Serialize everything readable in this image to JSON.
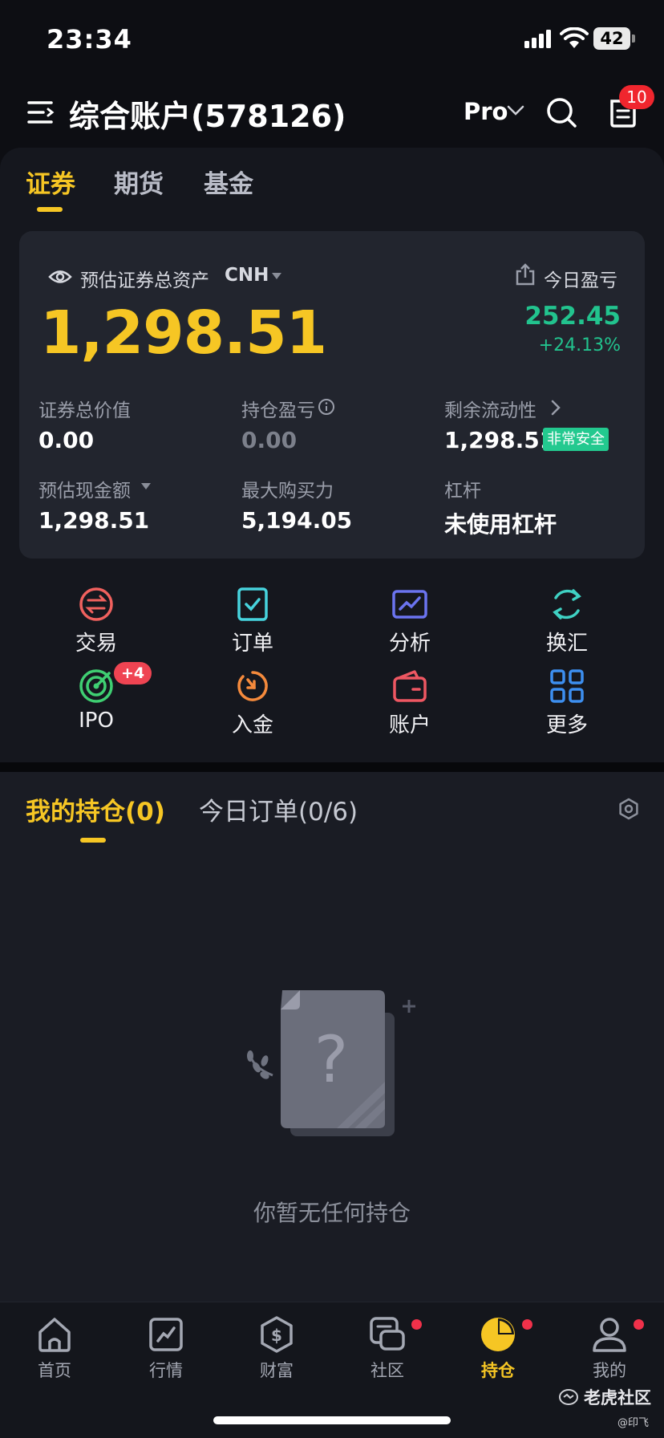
{
  "status_bar": {
    "time": "23:34",
    "battery": "42"
  },
  "header": {
    "account_title": "综合账户(578126)",
    "mode": "Pro",
    "notification_count": "10"
  },
  "asset_tabs": [
    "证券",
    "期货",
    "基金"
  ],
  "asset_card": {
    "total_label": "预估证券总资产",
    "currency": "CNH",
    "total_value": "1,298.51",
    "today_pnl_label": "今日盈亏",
    "today_pnl_value": "252.45",
    "today_pnl_pct": "+24.13%",
    "metrics": [
      {
        "label": "证券总价值",
        "value": "0.00"
      },
      {
        "label": "持仓盈亏",
        "value": "0.00"
      },
      {
        "label": "剩余流动性",
        "value": "1,298.51",
        "badge": "非常安全"
      },
      {
        "label": "预估现金额",
        "value": "1,298.51"
      },
      {
        "label": "最大购买力",
        "value": "5,194.05"
      },
      {
        "label": "杠杆",
        "value": "未使用杠杆"
      }
    ]
  },
  "quick_actions": [
    {
      "label": "交易",
      "icon": "trade-icon"
    },
    {
      "label": "订单",
      "icon": "order-icon"
    },
    {
      "label": "分析",
      "icon": "analysis-icon"
    },
    {
      "label": "换汇",
      "icon": "exchange-icon"
    },
    {
      "label": "IPO",
      "icon": "ipo-icon",
      "badge": "+4"
    },
    {
      "label": "入金",
      "icon": "deposit-icon"
    },
    {
      "label": "账户",
      "icon": "wallet-icon"
    },
    {
      "label": "更多",
      "icon": "grid-icon"
    }
  ],
  "positions": {
    "tab_holdings": "我的持仓(0)",
    "tab_today_orders": "今日订单(0/6)",
    "empty_text": "你暂无任何持仓"
  },
  "bottom_nav": [
    {
      "label": "首页",
      "icon": "home-icon"
    },
    {
      "label": "行情",
      "icon": "chart-icon"
    },
    {
      "label": "财富",
      "icon": "dollar-shield-icon"
    },
    {
      "label": "社区",
      "icon": "chat-icon"
    },
    {
      "label": "持仓",
      "icon": "pie-icon",
      "active": true
    },
    {
      "label": "我的",
      "icon": "person-icon"
    }
  ],
  "watermark": {
    "brand": "老虎社区",
    "user": "@印飞"
  },
  "colors": {
    "accent": "#f6c624",
    "gain": "#22c38e",
    "badge": "#f0262e",
    "panel": "#15171e",
    "card": "#22252e"
  }
}
